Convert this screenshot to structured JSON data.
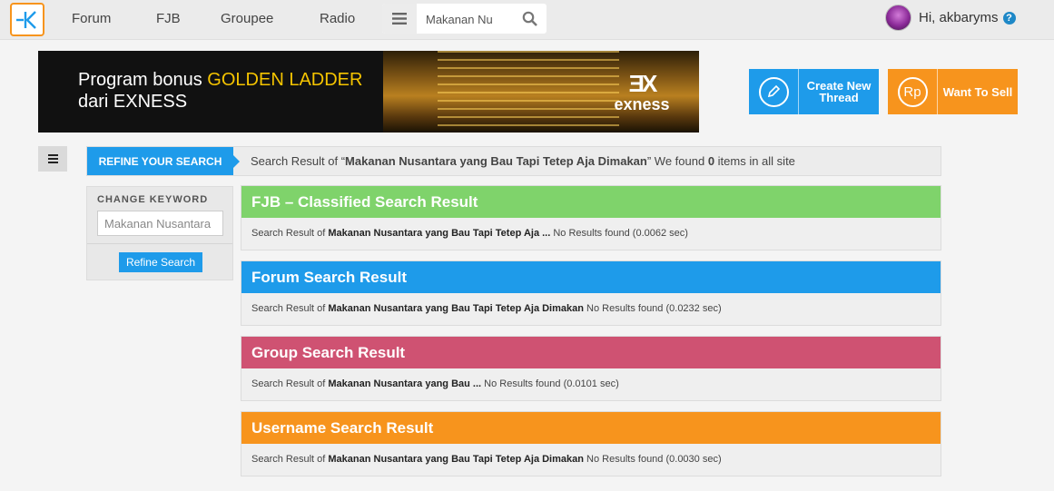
{
  "nav": {
    "links": [
      "Forum",
      "FJB",
      "Groupee",
      "Radio"
    ],
    "search_value": "Makanan Nu",
    "user_greeting": "Hi, akbaryms",
    "help": "?"
  },
  "banner": {
    "line1_prefix": "Program bonus ",
    "line1_highlight": "GOLDEN LADDER",
    "line2": "dari EXNESS",
    "brand_mark": "ƎX",
    "brand_name": "exness"
  },
  "actions": {
    "create_line1": "Create New",
    "create_line2": "Thread",
    "sell_icon": "Rp",
    "sell_label": "Want To Sell"
  },
  "refine": {
    "tab_label": "REFINE YOUR SEARCH",
    "summary_prefix": "Search Result of “",
    "summary_query": "Makanan Nusantara yang Bau Tapi Tetep Aja Dimakan",
    "summary_mid": "” We found ",
    "summary_count": "0",
    "summary_suffix": " items in all site"
  },
  "keyword_panel": {
    "title": "CHANGE KEYWORD",
    "input_value": "Makanan Nusantara",
    "button_label": "Refine Search"
  },
  "results": [
    {
      "title": "FJB – Classified Search Result",
      "prefix": "Search Result of ",
      "query": "Makanan Nusantara yang Bau Tapi Tetep Aja ...",
      "status": " No Results found (0.0062 sec)"
    },
    {
      "title": "Forum Search Result",
      "prefix": "Search Result of ",
      "query": "Makanan Nusantara yang Bau Tapi Tetep Aja Dimakan",
      "status": " No Results found (0.0232 sec)"
    },
    {
      "title": "Group Search Result",
      "prefix": "Search Result of ",
      "query": "Makanan Nusantara yang Bau ...",
      "status": " No Results found (0.0101 sec)"
    },
    {
      "title": "Username Search Result",
      "prefix": "Search Result of ",
      "query": "Makanan Nusantara yang Bau Tapi Tetep Aja Dimakan",
      "status": " No Results found (0.0030 sec)"
    }
  ],
  "colors": {
    "accent_blue": "#1e9bea",
    "accent_orange": "#f7941d",
    "fjb_green": "#7fd36b",
    "group_pink": "#cf5272"
  },
  "icons": {
    "logo": "kaskus-logo-icon",
    "menu": "hamburger-icon",
    "search": "search-icon",
    "help": "help-icon",
    "create": "pencil-icon",
    "sell": "rupiah-icon",
    "sidebar": "sidebar-toggle-icon"
  }
}
